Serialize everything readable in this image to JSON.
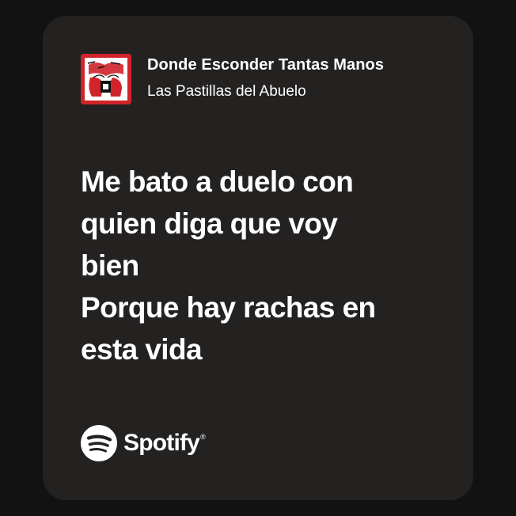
{
  "track": {
    "title": "Donde Esconder Tantas Manos",
    "artist": "Las Pastillas del Abuelo",
    "cover_icon": "album-cover-art"
  },
  "lyrics": [
    "Me bato a duelo con",
    "quien diga que voy",
    "bien",
    "Porque hay rachas en",
    "esta vida"
  ],
  "brand": {
    "name": "Spotify",
    "registered": "®",
    "icon": "spotify-logo-icon"
  },
  "colors": {
    "page_background": "#121212",
    "card_background": "#242121",
    "text": "#ffffff",
    "cover_red": "#d0242a"
  }
}
